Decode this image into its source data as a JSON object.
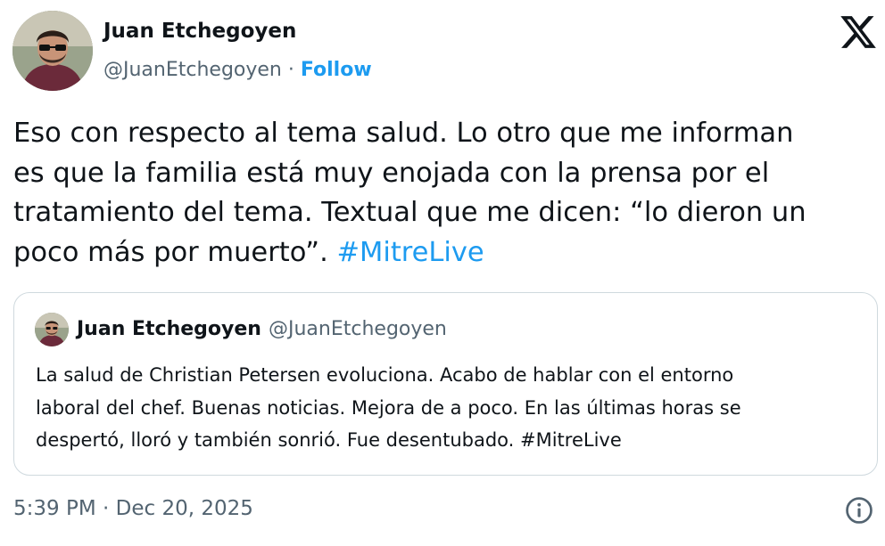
{
  "author": {
    "name": "Juan Etchegoyen",
    "handle": "@JuanEtchegoyen",
    "separator": " · ",
    "follow_label": "Follow",
    "avatar_icon": "profile-photo"
  },
  "brand_icon": "x-logo",
  "tweet": {
    "lines": [
      "Eso con respecto al tema salud. Lo otro que me informan",
      "es que la familia está muy enojada con la prensa por el",
      "tratamiento del tema. Textual que me dicen: “lo dieron un",
      "poco más por muerto”. "
    ],
    "hashtag": "#MitreLive"
  },
  "quote": {
    "name": "Juan Etchegoyen",
    "handle": "@JuanEtchegoyen",
    "lines": [
      "La salud de Christian Petersen evoluciona. Acabo de hablar con el entorno",
      "laboral del chef. Buenas noticias. Mejora de a poco. En las últimas horas se",
      "despertó, lloró y también sonrió. Fue desentubado. #MitreLive"
    ]
  },
  "timestamp": {
    "time": "5:39 PM",
    "separator": " · ",
    "date": "Dec 20, 2025"
  },
  "info_icon": "info-icon",
  "colors": {
    "link": "#1d9bf0",
    "text": "#0f1419",
    "muted": "#536471",
    "border": "#cfd9de"
  }
}
